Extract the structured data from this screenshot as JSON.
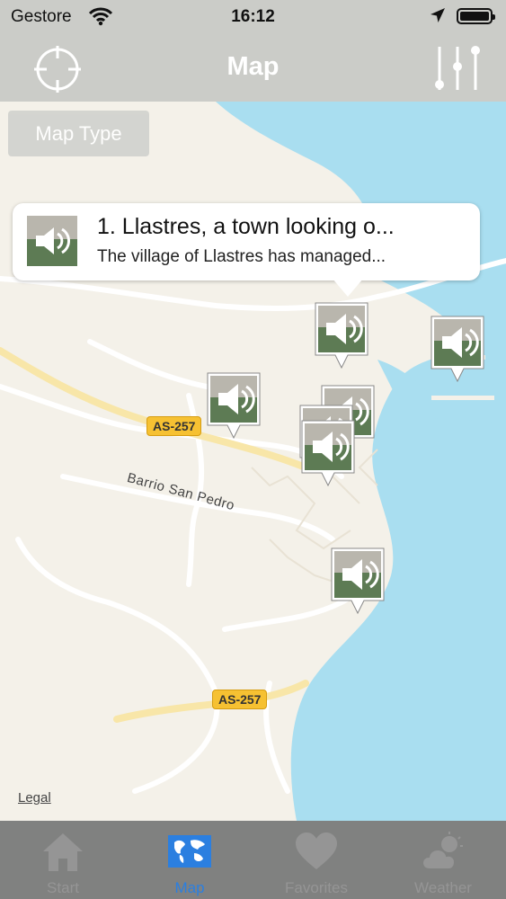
{
  "status_bar": {
    "carrier": "Gestore",
    "time": "16:12",
    "icons": [
      "wifi-icon",
      "location-arrow-icon",
      "battery-icon"
    ]
  },
  "nav_bar": {
    "title": "Map",
    "left_icon": "crosshair-locate-icon",
    "right_icon": "filter-sliders-icon"
  },
  "map": {
    "map_type_label": "Map Type",
    "legal_label": "Legal",
    "road_labels": [
      "AS-257",
      "AS-257"
    ],
    "street_label": "Barrio San Pedro",
    "callout": {
      "title": "1. Llastres, a town looking o...",
      "subtitle": "The village of Llastres has managed..."
    },
    "colors": {
      "land": "#f4f1e9",
      "water": "#a9def0",
      "road": "#ffffff",
      "highway": "#f8e6a8"
    }
  },
  "tab_bar": {
    "tabs": [
      {
        "label": "Start",
        "icon": "home-icon",
        "active": false
      },
      {
        "label": "Map",
        "icon": "world-map-icon",
        "active": true
      },
      {
        "label": "Favorites",
        "icon": "heart-icon",
        "active": false
      },
      {
        "label": "Weather",
        "icon": "weather-cloud-sun-icon",
        "active": false
      }
    ],
    "active_color": "#2b7fe0",
    "inactive_color": "#959595"
  }
}
